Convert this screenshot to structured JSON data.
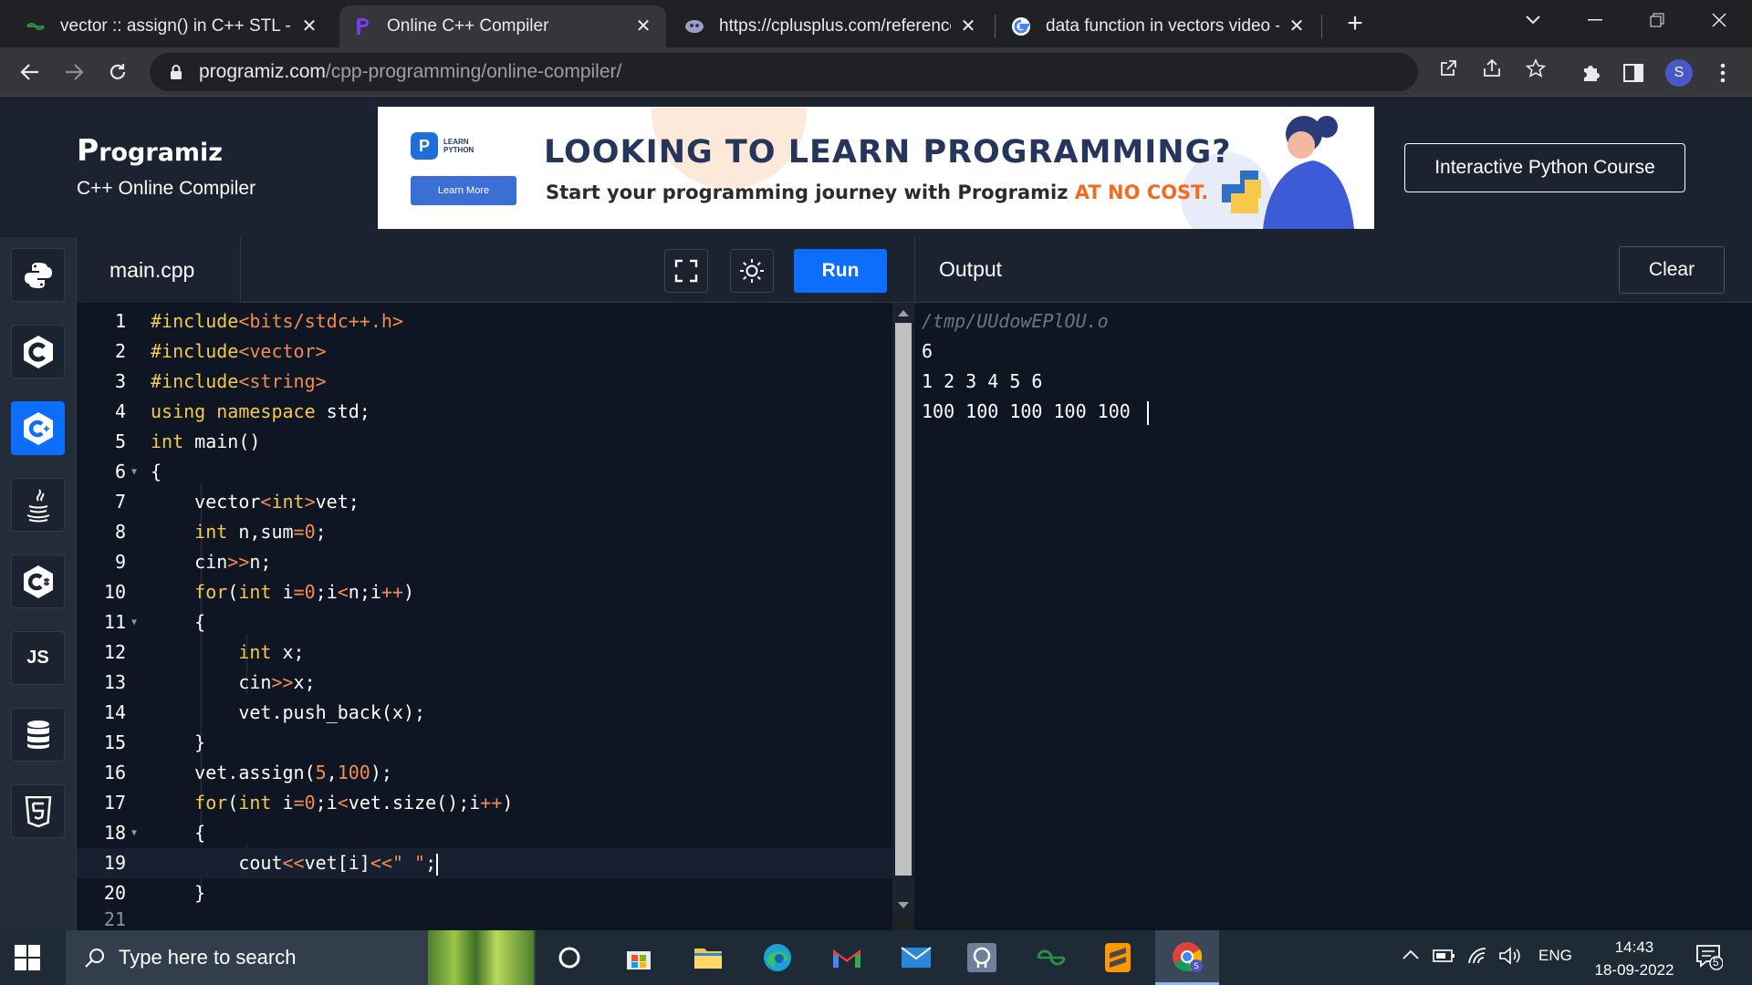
{
  "browser": {
    "tabs": [
      {
        "title": "vector :: assign() in C++ STL - Ge",
        "favicon": "geeksforgeeks-icon",
        "active": false
      },
      {
        "title": "Online C++ Compiler",
        "favicon": "programiz-icon",
        "active": true
      },
      {
        "title": "https://cplusplus.com/reference/",
        "favicon": "cplusplus-icon",
        "active": false
      },
      {
        "title": "data function in vectors video - G",
        "favicon": "google-icon",
        "active": false
      }
    ],
    "url_host": "programiz.com",
    "url_path": "/cpp-programming/online-compiler/",
    "profile_initial": "S"
  },
  "site": {
    "logo": "Programiz",
    "subtitle": "C++ Online Compiler",
    "banner": {
      "badge": "LEARN PYTHON",
      "learn_more": "Learn More",
      "headline": "LOOKING TO LEARN PROGRAMMING?",
      "tagline": "Start your programming journey with Programiz ",
      "tagline_accent": "AT NO COST."
    },
    "course_button": "Interactive Python Course"
  },
  "sidebar": {
    "languages": [
      {
        "name": "python",
        "label": "",
        "active": false
      },
      {
        "name": "c",
        "label": "",
        "active": false
      },
      {
        "name": "cpp",
        "label": "",
        "active": true
      },
      {
        "name": "java",
        "label": "",
        "active": false
      },
      {
        "name": "csharp",
        "label": "",
        "active": false
      },
      {
        "name": "javascript",
        "label": "JS",
        "active": false
      },
      {
        "name": "sql",
        "label": "",
        "active": false
      },
      {
        "name": "html",
        "label": "",
        "active": false
      }
    ]
  },
  "editor": {
    "filename": "main.cpp",
    "run_label": "Run",
    "lines": [
      {
        "n": "1",
        "html": "<span class='kw'>#include</span><span class='str'>&lt;bits/stdc++.h&gt;</span>",
        "text": "#include<bits/stdc++.h>"
      },
      {
        "n": "2",
        "html": "<span class='kw'>#include</span><span class='str'>&lt;vector&gt;</span>",
        "text": "#include<vector>"
      },
      {
        "n": "3",
        "html": "<span class='kw'>#include</span><span class='str'>&lt;string&gt;</span>",
        "text": "#include<string>"
      },
      {
        "n": "4",
        "html": "<span class='kw'>using namespace</span> std;",
        "text": "using namespace std;"
      },
      {
        "n": "5",
        "html": "<span class='kw'>int</span> main()",
        "text": "int main()"
      },
      {
        "n": "6",
        "html": "{",
        "text": "{",
        "fold": true
      },
      {
        "n": "7",
        "html": "    vector<span class='op'>&lt;</span><span class='kw'>int</span><span class='op'>&gt;</span>vet;",
        "text": "    vector<int>vet;"
      },
      {
        "n": "8",
        "html": "    <span class='kw'>int</span> n,sum<span class='op'>=</span><span class='num'>0</span>;",
        "text": "    int n,sum=0;"
      },
      {
        "n": "9",
        "html": "    cin<span class='op'>&gt;&gt;</span>n;",
        "text": "    cin>>n;"
      },
      {
        "n": "10",
        "html": "    <span class='kw'>for</span>(<span class='kw'>int</span> i<span class='op'>=</span><span class='num'>0</span>;i<span class='op'>&lt;</span>n;i<span class='op'>++</span>)",
        "text": "    for(int i=0;i<n;i++)"
      },
      {
        "n": "11",
        "html": "    {",
        "text": "    {",
        "fold": true
      },
      {
        "n": "12",
        "html": "        <span class='kw'>int</span> x;",
        "text": "        int x;"
      },
      {
        "n": "13",
        "html": "        cin<span class='op'>&gt;&gt;</span>x;",
        "text": "        cin>>x;"
      },
      {
        "n": "14",
        "html": "        vet.push_back(x);",
        "text": "        vet.push_back(x);"
      },
      {
        "n": "15",
        "html": "    }",
        "text": "    }"
      },
      {
        "n": "16",
        "html": "    vet.assign(<span class='num'>5</span>,<span class='num'>100</span>);",
        "text": "    vet.assign(5,100);"
      },
      {
        "n": "17",
        "html": "    <span class='kw'>for</span>(<span class='kw'>int</span> i<span class='op'>=</span><span class='num'>0</span>;i<span class='op'>&lt;</span>vet.size();i<span class='op'>++</span>)",
        "text": "    for(int i=0;i<vet.size();i++)"
      },
      {
        "n": "18",
        "html": "    {",
        "text": "    {",
        "fold": true
      },
      {
        "n": "19",
        "html": "        cout<span class='op'>&lt;&lt;</span>vet[i]<span class='op'>&lt;&lt;</span><span class='str'>\" \"</span>;",
        "text": "        cout<<vet[i]<<\" \";",
        "current": true
      },
      {
        "n": "20",
        "html": "    }",
        "text": "    }"
      }
    ]
  },
  "output": {
    "label": "Output",
    "clear_label": "Clear",
    "lines": [
      "/tmp/UUdowEPlOU.o",
      "6",
      "1 2 3 4 5 6",
      "100 100 100 100 100 "
    ]
  },
  "taskbar": {
    "search_placeholder": "Type here to search",
    "apps": [
      "cortana-icon",
      "microsoft-store-icon",
      "file-explorer-icon",
      "edge-icon",
      "gmail-icon",
      "mail-icon",
      "app-icon",
      "geeksforgeeks-icon",
      "sublime-text-icon",
      "chrome-icon"
    ],
    "language": "ENG",
    "time": "14:43",
    "date": "18-09-2022",
    "notifications": "5"
  }
}
